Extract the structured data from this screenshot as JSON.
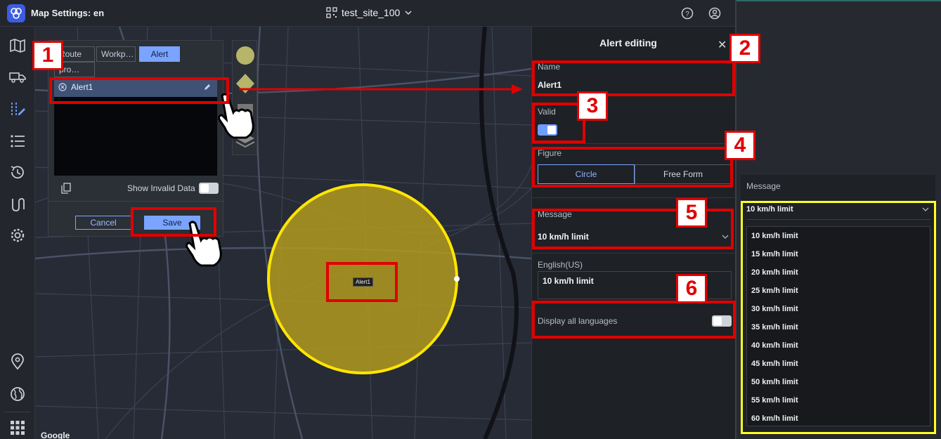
{
  "header": {
    "title": "Map Settings: en",
    "site": "test_site_100"
  },
  "layers": {
    "tabs": [
      "Route",
      "Workp…",
      "Alert",
      "pro…"
    ],
    "alert_item": "Alert1",
    "show_invalid_label": "Show Invalid Data",
    "cancel_label": "Cancel",
    "save_label": "Save"
  },
  "map": {
    "alert_label": "Alert1",
    "credit": "Google"
  },
  "editor": {
    "title": "Alert editing",
    "name_label": "Name",
    "name_value": "Alert1",
    "valid_label": "Valid",
    "figure_label": "Figure",
    "figure_options": [
      "Circle",
      "Free Form"
    ],
    "message_label": "Message",
    "message_value": "10 km/h limit",
    "english_label": "English(US)",
    "english_value": "10 km/h limit",
    "display_all_label": "Display all languages"
  },
  "dropdown": {
    "label": "Message",
    "value": "10 km/h limit",
    "options": [
      "10 km/h limit",
      "15 km/h limit",
      "20 km/h limit",
      "25 km/h limit",
      "30 km/h limit",
      "35 km/h limit",
      "40 km/h limit",
      "45 km/h limit",
      "50 km/h limit",
      "55 km/h limit",
      "60 km/h limit"
    ]
  },
  "annotations": [
    "1",
    "2",
    "3",
    "4",
    "5",
    "6"
  ],
  "colors": {
    "accent": "#7aa4ff",
    "highlight_red": "#e00000",
    "highlight_yellow": "#ffff22",
    "circle_fill": "#b39a1d"
  }
}
